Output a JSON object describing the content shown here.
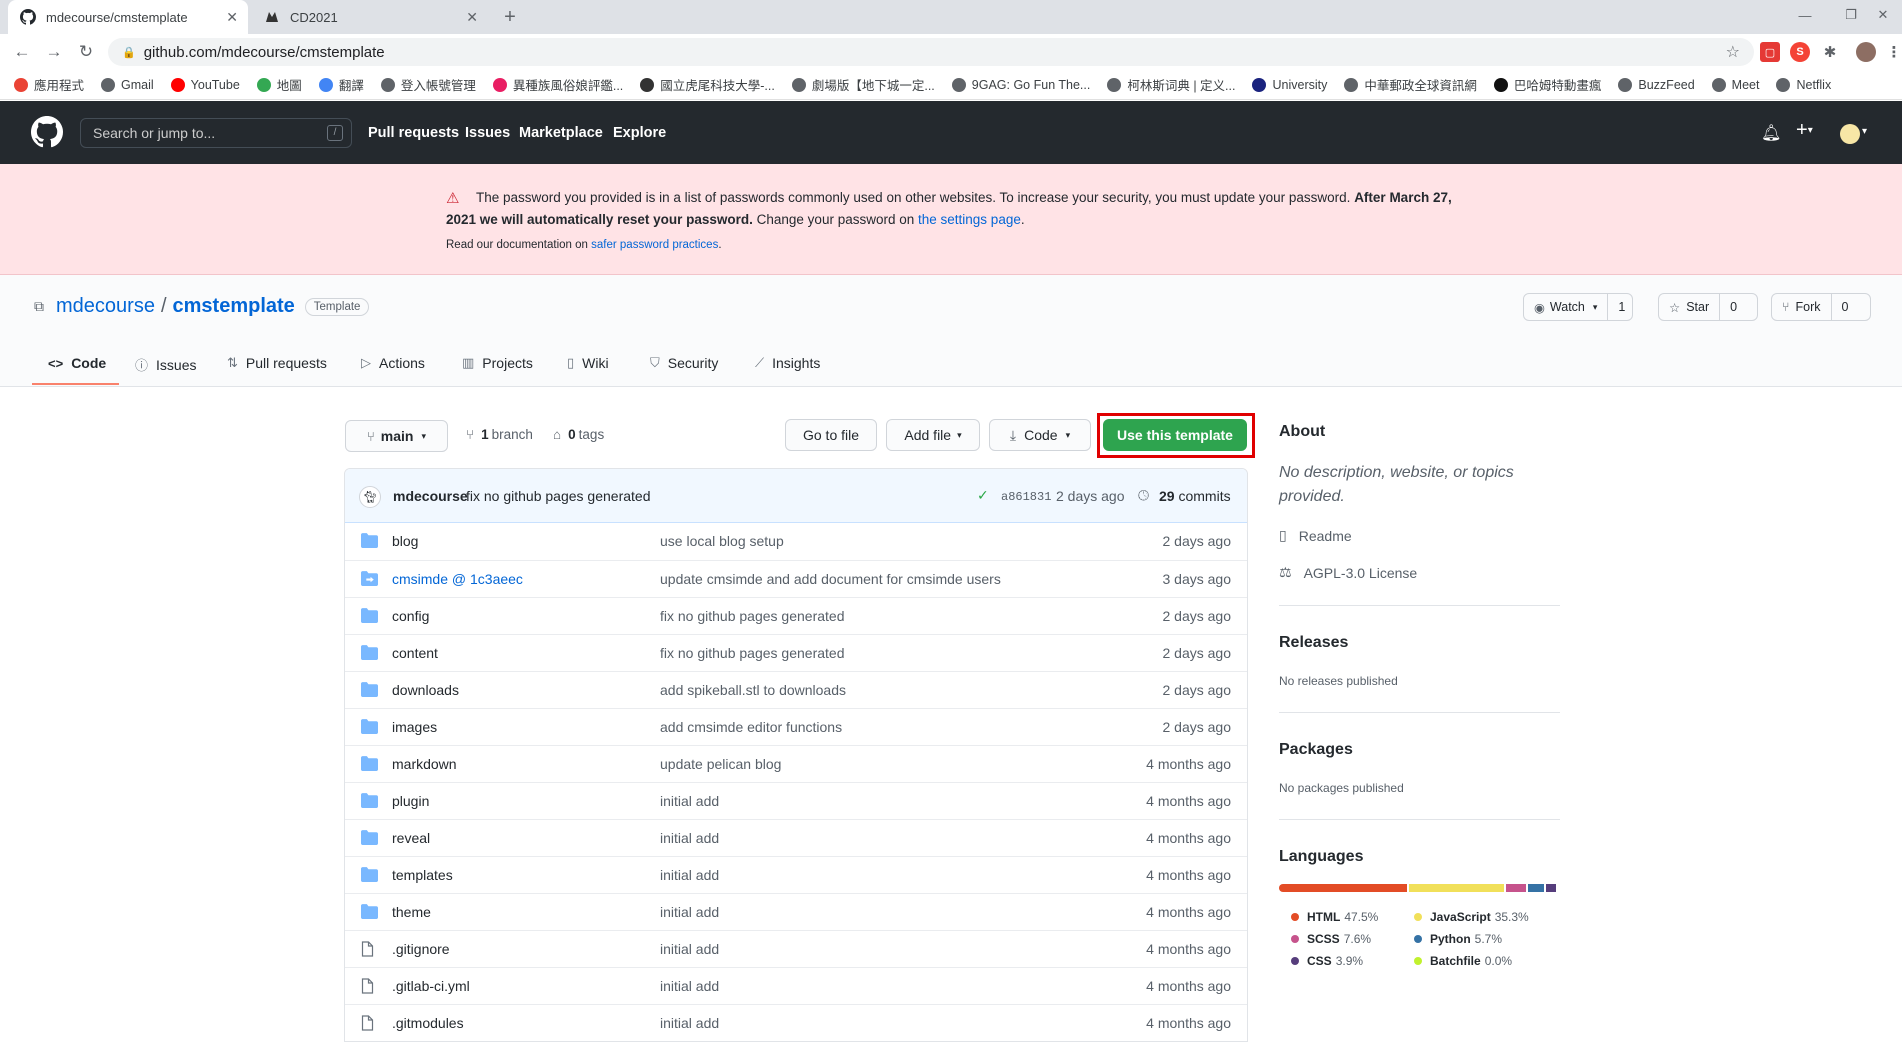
{
  "browser": {
    "tabs": [
      {
        "title": "mdecourse/cmstemplate",
        "active": true
      },
      {
        "title": "CD2021",
        "active": false
      }
    ],
    "url": "github.com/mdecourse/cmstemplate",
    "bookmarks": [
      {
        "label": "應用程式",
        "color": "#ea4335"
      },
      {
        "label": "Gmail",
        "color": "#5f6368"
      },
      {
        "label": "YouTube",
        "color": "#ff0000"
      },
      {
        "label": "地圖",
        "color": "#34a853"
      },
      {
        "label": "翻譯",
        "color": "#4285f4"
      },
      {
        "label": "登入帳號管理",
        "color": "#5f6368"
      },
      {
        "label": "異種族風俗娘評鑑...",
        "color": "#e91e63"
      },
      {
        "label": "國立虎尾科技大學-...",
        "color": "#333333"
      },
      {
        "label": "劇場版【地下城一定...",
        "color": "#5f6368"
      },
      {
        "label": "9GAG: Go Fun The...",
        "color": "#5f6368"
      },
      {
        "label": "柯林斯词典 | 定义...",
        "color": "#5f6368"
      },
      {
        "label": "University",
        "color": "#1a237e"
      },
      {
        "label": "中華郵政全球資訊網",
        "color": "#5f6368"
      },
      {
        "label": "巴哈姆特動畫瘋",
        "color": "#111111"
      },
      {
        "label": "BuzzFeed",
        "color": "#5f6368"
      },
      {
        "label": "Meet",
        "color": "#5f6368"
      },
      {
        "label": "Netflix",
        "color": "#5f6368"
      }
    ]
  },
  "header": {
    "search_placeholder": "Search or jump to...",
    "search_key": "/",
    "nav": [
      "Pull requests",
      "Issues",
      "Marketplace",
      "Explore"
    ]
  },
  "flash": {
    "text_a": "The password you provided is in a list of passwords commonly used on other websites. To increase your security, you must update your password.",
    "text_b": "After March 27, 2021 we will automatically reset your password.",
    "text_c": "Change your password on",
    "link": "the settings page",
    "text_d": ".",
    "doc_a": "Read our documentation on",
    "doc_link": "safer password practices",
    "doc_b": "."
  },
  "repo": {
    "owner": "mdecourse",
    "sep": "/",
    "name": "cmstemplate",
    "badge": "Template",
    "watch": {
      "label": "Watch",
      "count": "1"
    },
    "star": {
      "label": "Star",
      "count": "0"
    },
    "fork": {
      "label": "Fork",
      "count": "0"
    },
    "tabs": [
      "Code",
      "Issues",
      "Pull requests",
      "Actions",
      "Projects",
      "Wiki",
      "Security",
      "Insights"
    ]
  },
  "filenav": {
    "branch": "main",
    "branches_count": "1",
    "branches_label": "branch",
    "tags_count": "0",
    "tags_label": "tags",
    "goto": "Go to file",
    "addfile": "Add file",
    "code": "Code",
    "use_template": "Use this template"
  },
  "commit": {
    "author": "mdecourse",
    "message": "fix no github pages generated",
    "sha": "a861831",
    "time": "2 days ago",
    "commits_count": "29",
    "commits_label": "commits"
  },
  "files": [
    {
      "name": "blog",
      "type": "dir",
      "msg": "use local blog setup",
      "time": "2 days ago"
    },
    {
      "name": "cmsimde @ 1c3aeec",
      "type": "submodule",
      "msg": "update cmsimde and add document for cmsimde users",
      "time": "3 days ago"
    },
    {
      "name": "config",
      "type": "dir",
      "msg": "fix no github pages generated",
      "time": "2 days ago"
    },
    {
      "name": "content",
      "type": "dir",
      "msg": "fix no github pages generated",
      "time": "2 days ago"
    },
    {
      "name": "downloads",
      "type": "dir",
      "msg": "add spikeball.stl to downloads",
      "time": "2 days ago"
    },
    {
      "name": "images",
      "type": "dir",
      "msg": "add cmsimde editor functions",
      "time": "2 days ago"
    },
    {
      "name": "markdown",
      "type": "dir",
      "msg": "update pelican blog",
      "time": "4 months ago"
    },
    {
      "name": "plugin",
      "type": "dir",
      "msg": "initial add",
      "time": "4 months ago"
    },
    {
      "name": "reveal",
      "type": "dir",
      "msg": "initial add",
      "time": "4 months ago"
    },
    {
      "name": "templates",
      "type": "dir",
      "msg": "initial add",
      "time": "4 months ago"
    },
    {
      "name": "theme",
      "type": "dir",
      "msg": "initial add",
      "time": "4 months ago"
    },
    {
      "name": ".gitignore",
      "type": "file",
      "msg": "initial add",
      "time": "4 months ago"
    },
    {
      "name": ".gitlab-ci.yml",
      "type": "file",
      "msg": "initial add",
      "time": "4 months ago"
    },
    {
      "name": ".gitmodules",
      "type": "file",
      "msg": "initial add",
      "time": "4 months ago"
    }
  ],
  "sidebar": {
    "about_title": "About",
    "about_desc": "No description, website, or topics provided.",
    "readme": "Readme",
    "license": "AGPL-3.0 License",
    "releases_title": "Releases",
    "releases_text": "No releases published",
    "packages_title": "Packages",
    "packages_text": "No packages published",
    "languages_title": "Languages",
    "languages": [
      {
        "name": "HTML",
        "pct": "47.5%",
        "value": 47.5,
        "color": "#e34c26"
      },
      {
        "name": "JavaScript",
        "pct": "35.3%",
        "value": 35.3,
        "color": "#f1e05a"
      },
      {
        "name": "SCSS",
        "pct": "7.6%",
        "value": 7.6,
        "color": "#c6538c"
      },
      {
        "name": "Python",
        "pct": "5.7%",
        "value": 5.7,
        "color": "#3572a5"
      },
      {
        "name": "CSS",
        "pct": "3.9%",
        "value": 3.9,
        "color": "#563d7c"
      },
      {
        "name": "Batchfile",
        "pct": "0.0%",
        "value": 0.0,
        "color": "#c1f12e"
      }
    ]
  },
  "colors": {
    "accent_green": "#2ea44f",
    "link_blue": "#0366d6",
    "highlight_red": "#e00000"
  }
}
